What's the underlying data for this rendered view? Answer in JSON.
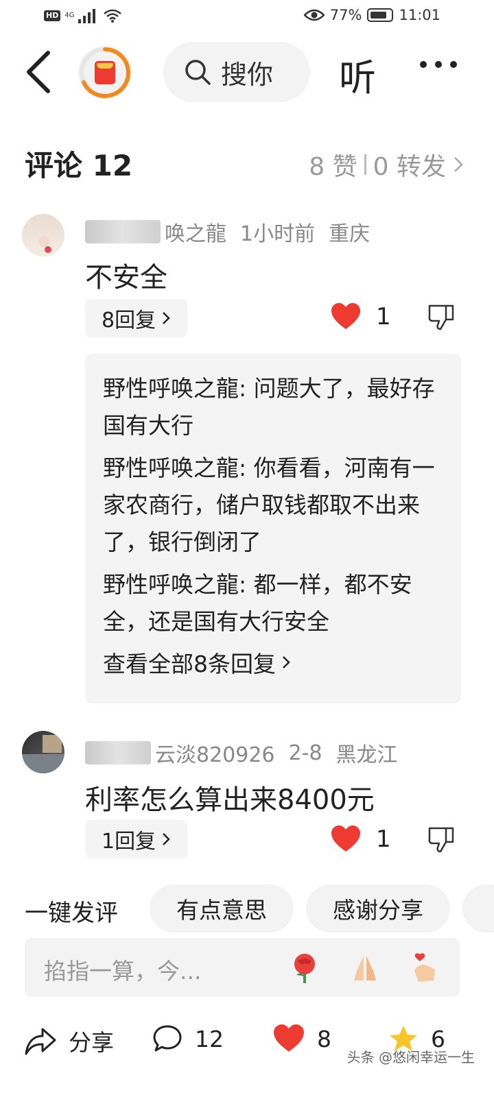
{
  "status_bar": {
    "network": "HD",
    "signal": "4G",
    "battery": "77%",
    "time": "11:01"
  },
  "top_bar": {
    "search_placeholder": "搜你",
    "listen_label": "听"
  },
  "comments_header": {
    "title": "评论 12",
    "likes": "8 赞",
    "reposts": "0 转发"
  },
  "comments": [
    {
      "user": "唤之龍",
      "time": "1小时前",
      "location": "重庆",
      "text": "不安全",
      "reply_count_label": "8回复",
      "likes": "1",
      "replies": [
        "野性呼唤之龍: 问题大了，最好存国有大行",
        "野性呼唤之龍: 你看看，河南有一家农商行，储户取钱都取不出来了，银行倒闭了",
        "野性呼唤之龍: 都一样，都不安全，还是国有大行安全"
      ],
      "view_all_label": "查看全部8条回复"
    },
    {
      "user": "云淡820926",
      "time": "2-8",
      "location": "黑龙江",
      "text": "利率怎么算出来8400元",
      "reply_count_label": "1回复",
      "likes": "1"
    }
  ],
  "quick_reply": {
    "label": "一键发评",
    "chips": [
      "有点意思",
      "感谢分享"
    ]
  },
  "input": {
    "placeholder": "掐指一算，今..."
  },
  "bottom_bar": {
    "share_label": "分享",
    "comment_count": "12",
    "like_count": "8",
    "favorite_count": "6"
  },
  "watermark": "头条 @悠闲幸运一生",
  "colors": {
    "accent_red": "#ee3b32",
    "ring_orange": "#f08a1c",
    "star_yellow": "#f7c52b",
    "muted_text": "#888888"
  }
}
